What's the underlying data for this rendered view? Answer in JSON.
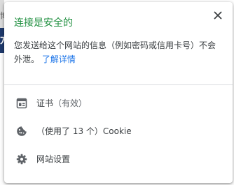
{
  "background": {
    "glyph_top": "博",
    "glyph_blue": "方"
  },
  "popup": {
    "title": "连接是安全的",
    "description": "您发送给这个网站的信息（例如密码或信用卡号）不会外泄。",
    "learn_more": "了解详情",
    "close_icon": "close-icon",
    "colors": {
      "title": "#1e8e3e",
      "link": "#1a73e8",
      "text": "#3c4043",
      "icon": "#5f6368"
    },
    "items": [
      {
        "icon": "certificate-icon",
        "label": "证书",
        "sub": "（有效）"
      },
      {
        "icon": "cookie-icon",
        "label": "（使用了 13 个）Cookie"
      },
      {
        "icon": "gear-icon",
        "label": "网站设置"
      }
    ]
  }
}
